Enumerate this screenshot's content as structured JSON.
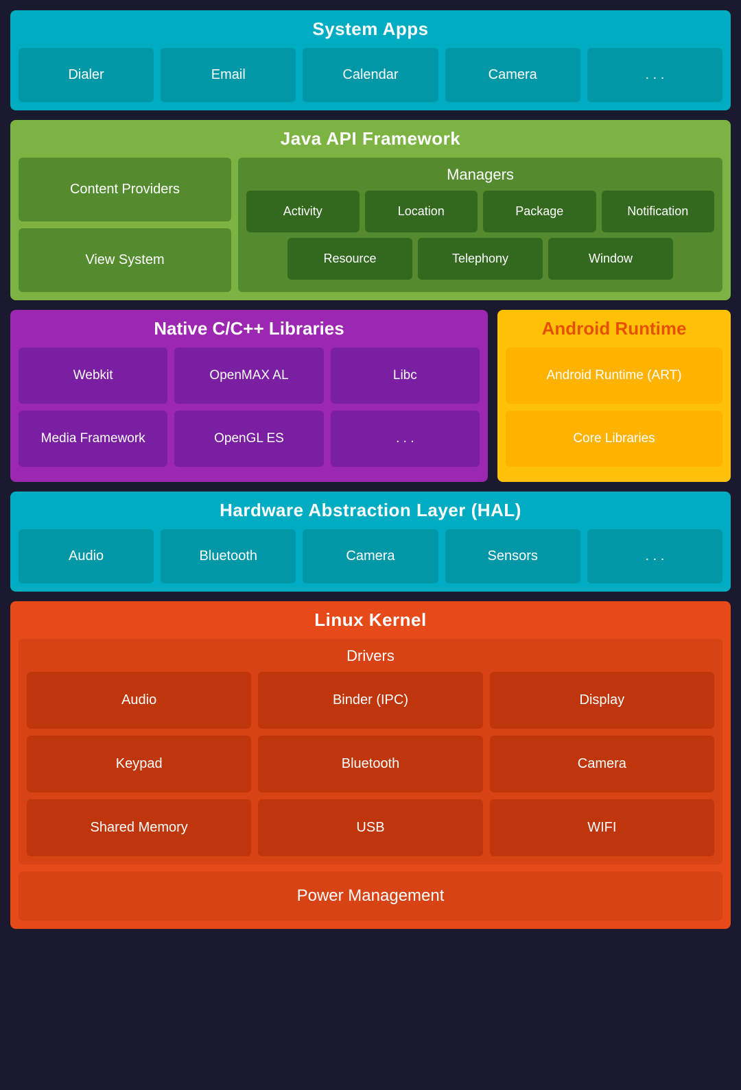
{
  "systemApps": {
    "title": "System Apps",
    "items": [
      "Dialer",
      "Email",
      "Calendar",
      "Camera",
      ". . ."
    ]
  },
  "javaApi": {
    "title": "Java API Framework",
    "left": {
      "contentProviders": "Content Providers",
      "viewSystem": "View System"
    },
    "managers": {
      "title": "Managers",
      "row1": [
        "Activity",
        "Location",
        "Package",
        "Notification"
      ],
      "row2": [
        "Resource",
        "Telephony",
        "Window"
      ]
    }
  },
  "nativeCpp": {
    "title": "Native C/C++ Libraries",
    "items": [
      "Webkit",
      "OpenMAX AL",
      "Libc",
      "Media Framework",
      "OpenGL ES",
      ". . ."
    ]
  },
  "androidRuntime": {
    "title": "Android Runtime",
    "items": [
      "Android Runtime (ART)",
      "Core Libraries"
    ]
  },
  "hal": {
    "title": "Hardware Abstraction Layer (HAL)",
    "items": [
      "Audio",
      "Bluetooth",
      "Camera",
      "Sensors",
      ". . ."
    ]
  },
  "linuxKernel": {
    "title": "Linux Kernel",
    "drivers": {
      "title": "Drivers",
      "items": [
        "Audio",
        "Binder (IPC)",
        "Display",
        "Keypad",
        "Bluetooth",
        "Camera",
        "Shared Memory",
        "USB",
        "WIFI"
      ]
    },
    "powerManagement": "Power Management"
  }
}
